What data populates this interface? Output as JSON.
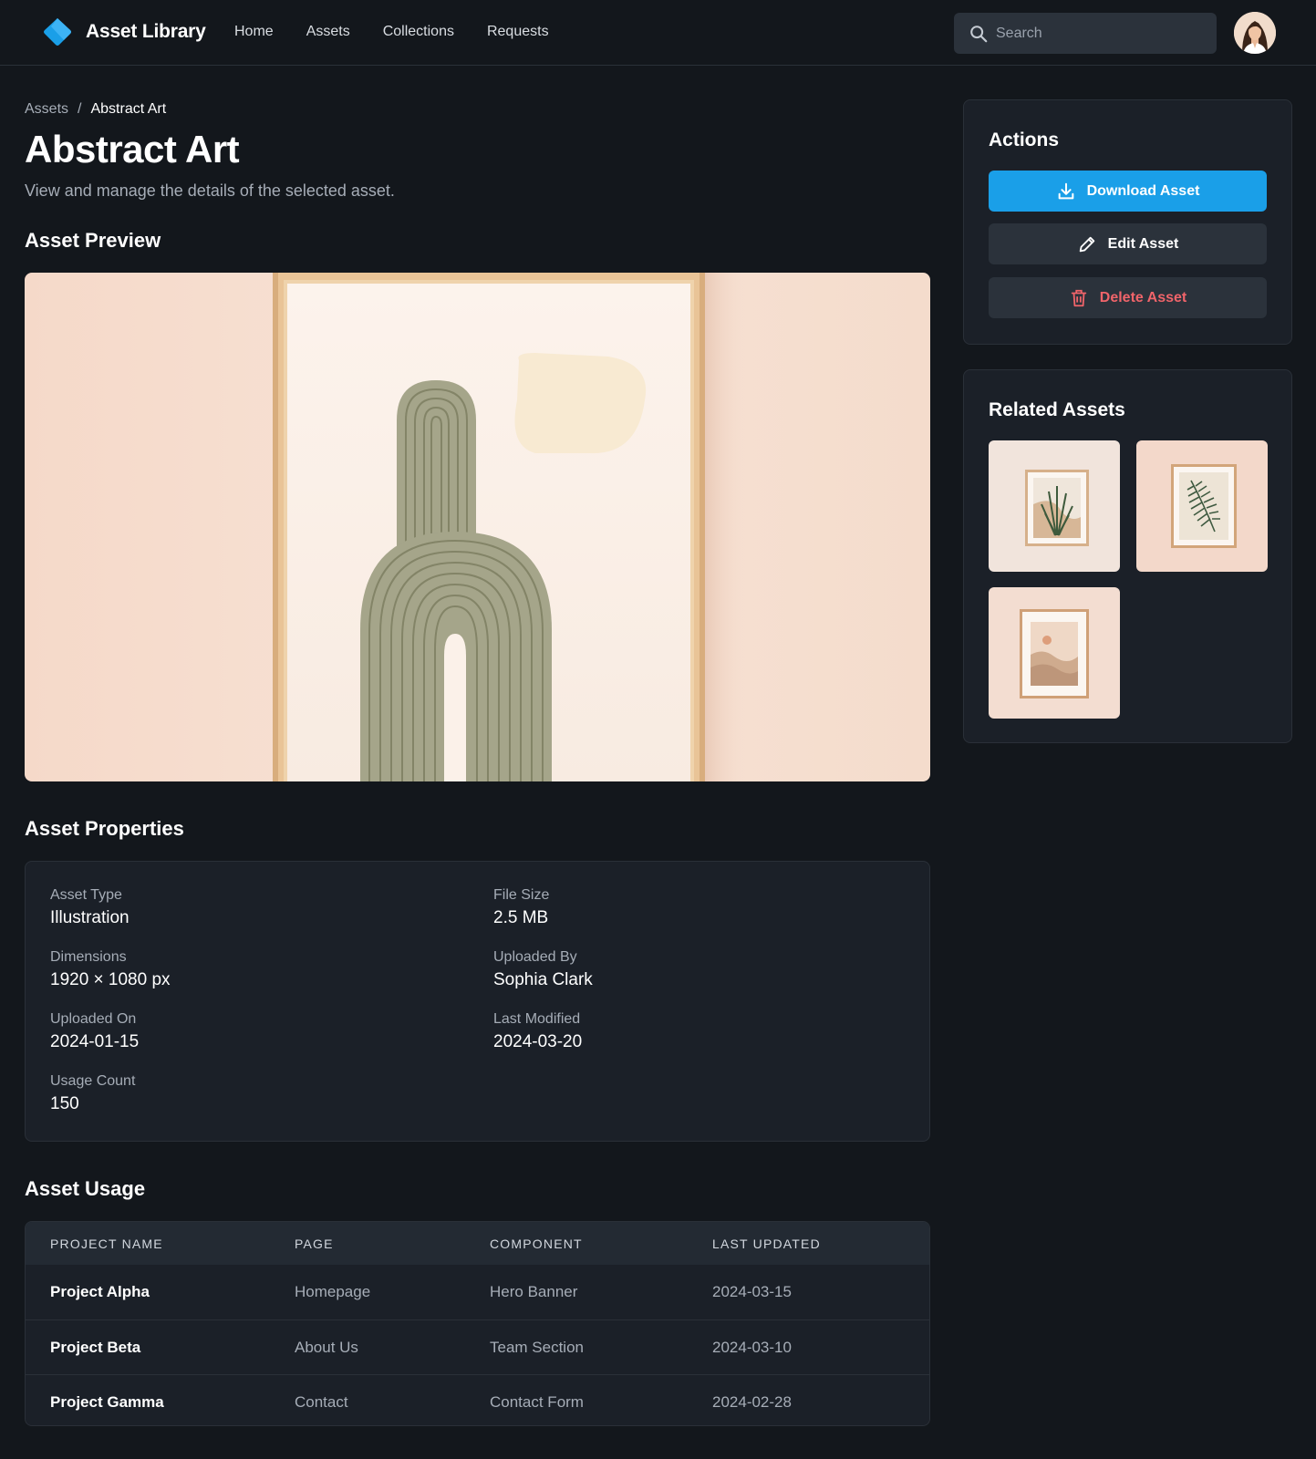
{
  "header": {
    "app_name": "Asset Library",
    "nav": [
      "Home",
      "Assets",
      "Collections",
      "Requests"
    ],
    "search_placeholder": "Search",
    "accent_color": "#1a9fe8"
  },
  "breadcrumb": {
    "parent": "Assets",
    "separator": "/",
    "current": "Abstract Art"
  },
  "page": {
    "title": "Abstract Art",
    "subtitle": "View and manage the details of the selected asset."
  },
  "preview": {
    "title": "Asset Preview"
  },
  "properties": {
    "title": "Asset Properties",
    "items": [
      {
        "label": "Asset Type",
        "value": "Illustration"
      },
      {
        "label": "File Size",
        "value": "2.5 MB"
      },
      {
        "label": "Dimensions",
        "value": "1920 × 1080 px"
      },
      {
        "label": "Uploaded By",
        "value": "Sophia Clark"
      },
      {
        "label": "Uploaded On",
        "value": "2024-01-15"
      },
      {
        "label": "Last Modified",
        "value": "2024-03-20"
      },
      {
        "label": "Usage Count",
        "value": "150"
      }
    ]
  },
  "usage": {
    "title": "Asset Usage",
    "columns": [
      "PROJECT NAME",
      "PAGE",
      "COMPONENT",
      "LAST UPDATED"
    ],
    "rows": [
      [
        "Project Alpha",
        "Homepage",
        "Hero Banner",
        "2024-03-15"
      ],
      [
        "Project Beta",
        "About Us",
        "Team Section",
        "2024-03-10"
      ],
      [
        "Project Gamma",
        "Contact",
        "Contact Form",
        "2024-02-28"
      ]
    ]
  },
  "actions": {
    "title": "Actions",
    "download": "Download Asset",
    "edit": "Edit Asset",
    "delete": "Delete Asset",
    "danger_color": "#f0646a"
  },
  "related": {
    "title": "Related Assets"
  }
}
